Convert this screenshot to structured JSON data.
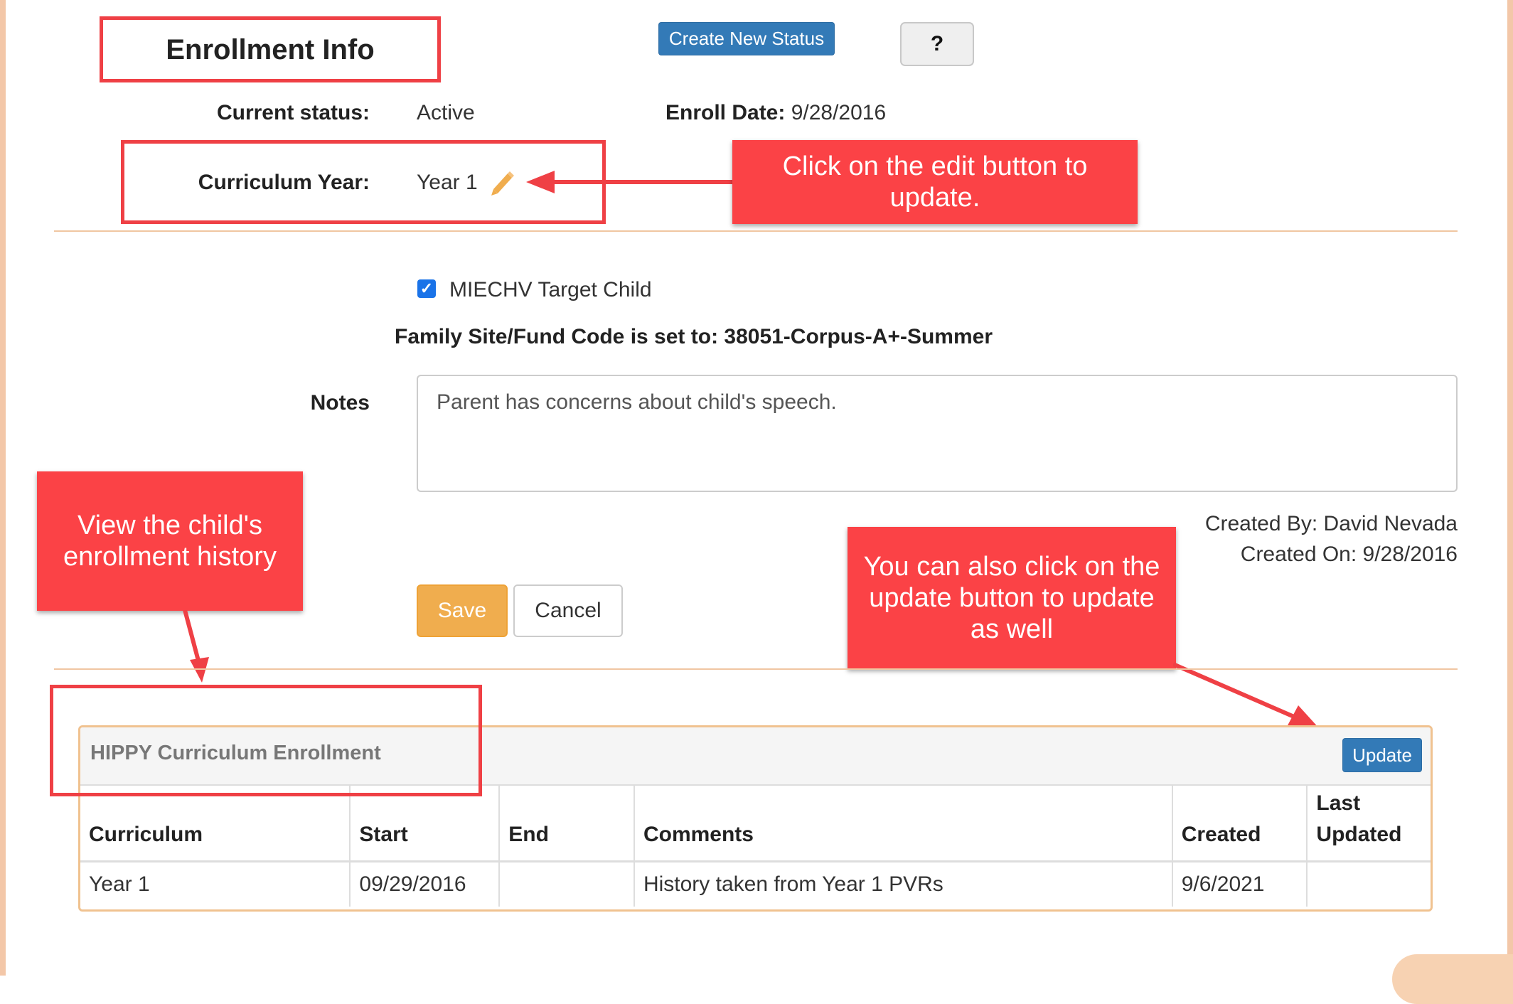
{
  "header": {
    "title": "Enrollment Info",
    "create_status_button": "Create New Status",
    "help_button": "?"
  },
  "status": {
    "current_status_label": "Current status:",
    "current_status_value": "Active",
    "enroll_date_label": "Enroll Date:",
    "enroll_date_value": "9/28/2016",
    "curriculum_year_label": "Curriculum Year:",
    "curriculum_year_value": "Year 1",
    "edit_icon": "pencil-icon"
  },
  "form": {
    "miechv_label": "MIECHV Target Child",
    "miechv_checked": true,
    "fund_code_text": "Family Site/Fund Code is set to: 38051-Corpus-A+-Summer",
    "notes_label": "Notes",
    "notes_value": "Parent has concerns about child's speech.",
    "created_by": "Created By: David Nevada",
    "created_on": "Created On: 9/28/2016",
    "save_button": "Save",
    "cancel_button": "Cancel"
  },
  "curriculum_panel": {
    "title": "HIPPY Curriculum Enrollment",
    "update_button": "Update",
    "columns": [
      "Curriculum",
      "Start",
      "End",
      "Comments",
      "Created",
      "Last Updated"
    ],
    "rows": [
      [
        "Year 1",
        "09/29/2016",
        "",
        "History taken from Year 1 PVRs",
        "9/6/2021",
        ""
      ]
    ]
  },
  "annotations": {
    "edit_callout": "Click on the edit button to update.",
    "history_callout": "View the child's enrollment history",
    "update_callout": "You can also click on the update button to update as well"
  },
  "colors": {
    "callout_red": "#fb4246",
    "primary_blue": "#337ab7",
    "save_orange": "#f0ad4e",
    "panel_border": "#f0c290"
  }
}
